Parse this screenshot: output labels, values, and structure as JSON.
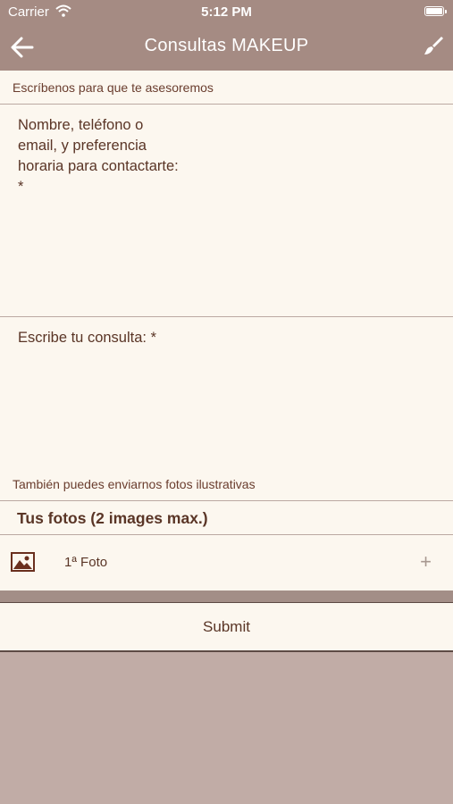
{
  "status_bar": {
    "carrier": "Carrier",
    "time": "5:12 PM"
  },
  "nav": {
    "title": "Consultas MAKEUP",
    "back_icon": "arrow-left-icon",
    "action_icon": "brush-icon"
  },
  "form": {
    "intro": "Escríbenos para que te asesoremos",
    "contact_field_label": "Nombre, teléfono o\nemail, y preferencia\nhoraria para contactarte:\n*",
    "query_field_label": "Escribe tu consulta: *",
    "photos_hint": "También puedes enviarnos fotos ilustrativas",
    "photos_title": "Tus fotos (2 images max.)",
    "photo_item_label": "1ª Foto",
    "add_icon": "+"
  },
  "submit_label": "Submit",
  "colors": {
    "nav_bg": "#a58b83",
    "content_bg": "#fcf7ef",
    "text": "#5a3526",
    "page_bg": "#c1aca6"
  }
}
